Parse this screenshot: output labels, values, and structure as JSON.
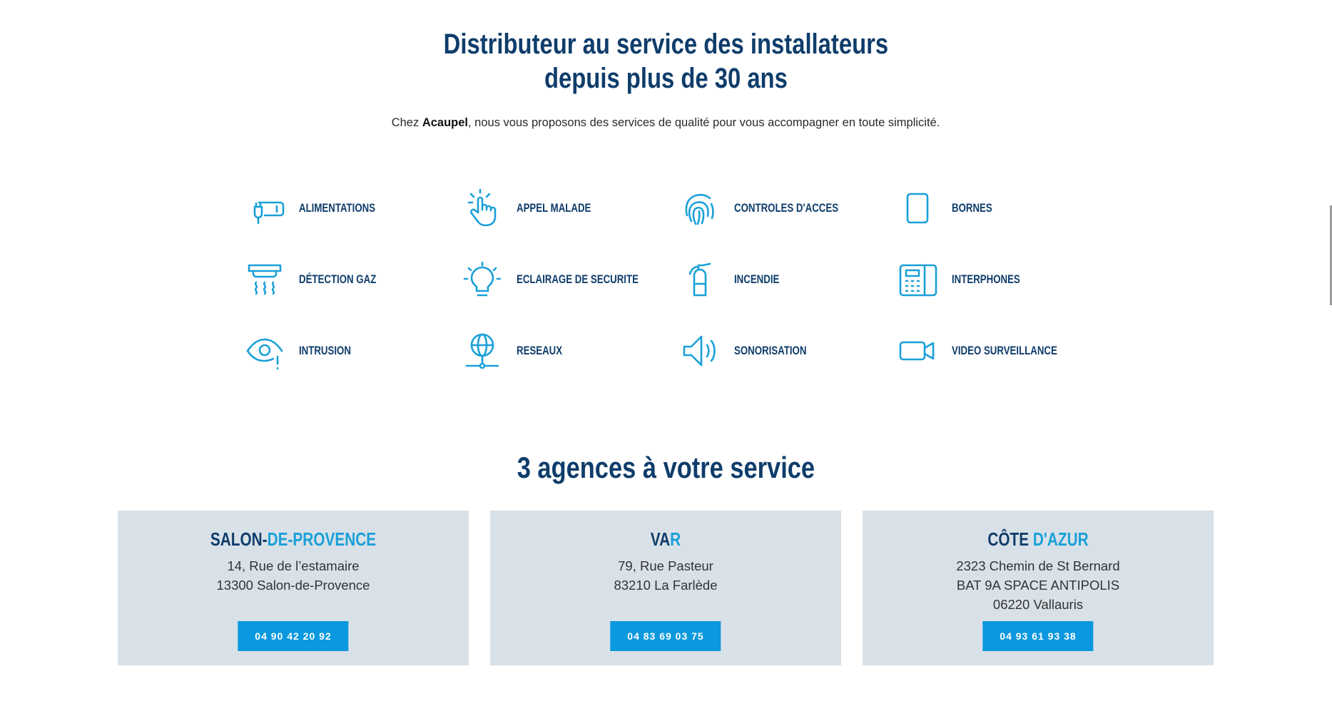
{
  "headline": {
    "line1": "Distributeur au service des installateurs",
    "line2": "depuis plus de 30 ans"
  },
  "intro": {
    "prefix": "Chez ",
    "brand": "Acaupel",
    "suffix": ", nous vous proposons des services de qualité pour vous accompagner en toute simplicité."
  },
  "colors": {
    "primary": "#0f3d6b",
    "accent": "#1aa0d8",
    "button": "#0a98de",
    "card": "#d9e1e8"
  },
  "services": [
    {
      "label": "ALIMENTATIONS",
      "icon": "power-plug-battery-icon"
    },
    {
      "label": "APPEL MALADE",
      "icon": "touch-hand-icon"
    },
    {
      "label": "CONTROLES D'ACCES",
      "icon": "fingerprint-icon"
    },
    {
      "label": "BORNES",
      "icon": "terminal-icon"
    },
    {
      "label": "DÉTECTION GAZ",
      "icon": "gas-detector-icon"
    },
    {
      "label": "ECLAIRAGE DE SECURITE",
      "icon": "lightbulb-icon"
    },
    {
      "label": "INCENDIE",
      "icon": "fire-extinguisher-icon"
    },
    {
      "label": "INTERPHONES",
      "icon": "intercom-icon"
    },
    {
      "label": "INTRUSION",
      "icon": "eye-alert-icon"
    },
    {
      "label": "RESEAUX",
      "icon": "globe-network-icon"
    },
    {
      "label": "SONORISATION",
      "icon": "speaker-icon"
    },
    {
      "label": "VIDEO SURVEILLANCE",
      "icon": "video-camera-icon"
    }
  ],
  "agencies_title": "3 agences à votre service",
  "agencies": [
    {
      "name_part1": "SALON-",
      "name_part2": "DE-PROVENCE",
      "address": [
        "14, Rue de l’estamaire",
        "13300 Salon-de-Provence"
      ],
      "phone": "04 90 42 20 92"
    },
    {
      "name_part1": "VA",
      "name_part2": "R",
      "address": [
        "79, Rue Pasteur",
        "83210 La Farlède"
      ],
      "phone": "04 83 69 03 75"
    },
    {
      "name_part1": "CÔTE ",
      "name_part2": "D'AZUR",
      "address": [
        "2323 Chemin de St Bernard",
        "BAT 9A SPACE ANTIPOLIS",
        "06220 Vallauris"
      ],
      "phone": "04 93 61 93 38"
    }
  ]
}
